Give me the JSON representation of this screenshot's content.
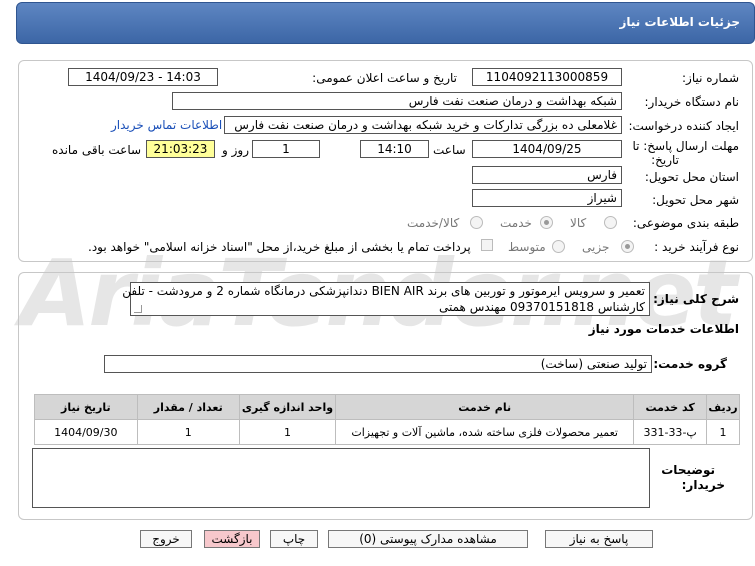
{
  "header": {
    "title": "جزئیات اطلاعات نیاز"
  },
  "form": {
    "need_number_label": "شماره نیاز:",
    "need_number": "1104092113000859",
    "announce_label": "تاریخ و ساعت اعلان عمومی:",
    "announce_value": "1404/09/23 - 14:03",
    "buyer_org_label": "نام دستگاه خریدار:",
    "buyer_org": "شبکه بهداشت و درمان صنعت نفت فارس",
    "creator_label": "ایجاد کننده درخواست:",
    "creator": "غلامعلی ده بزرگی تدارکات و خرید شبکه بهداشت و درمان صنعت نفت فارس",
    "contact_link": "اطلاعات تماس خریدار",
    "deadline_label_1": "مهلت ارسال پاسخ: تا",
    "deadline_label_2": "تاریخ:",
    "deadline_date": "1404/09/25",
    "time_label": "ساعت",
    "deadline_time": "14:10",
    "days_value": "1",
    "days_label": "روز و",
    "remaining_value": "21:03:23",
    "remaining_label": "ساعت باقی مانده",
    "province_label": "استان محل تحویل:",
    "province": "فارس",
    "city_label": "شهر محل تحویل:",
    "city": "شیراز",
    "category_label": "طبقه بندی موضوعی:",
    "category_options": [
      "کالا",
      "خدمت",
      "کالا/خدمت"
    ],
    "category_selected": "خدمت",
    "process_label": "نوع فرآیند خرید :",
    "process_options": [
      "جزیی",
      "متوسط"
    ],
    "process_selected": "جزیی",
    "treasury_note": "پرداخت تمام یا بخشی از مبلغ خرید،از محل \"اسناد خزانه اسلامی\" خواهد بود."
  },
  "description": {
    "label": "شرح کلی نیاز:",
    "line1": "تعمیر و سرویس ایرموتور و توربین های برند BIEN AIR دندانپزشکی درمانگاه شماره 2 و مرودشت - تلفن",
    "line2": "کارشناس 09370151818 مهندس همتی"
  },
  "services": {
    "section_title": "اطلاعات خدمات مورد نیاز",
    "group_label": "گروه خدمت:",
    "group_value": "تولید صنعتی (ساخت)",
    "columns": [
      "ردیف",
      "کد خدمت",
      "نام خدمت",
      "واحد اندازه گیری",
      "تعداد / مقدار",
      "تاریخ نیاز"
    ],
    "rows": [
      [
        "1",
        "پ-33-331",
        "تعمیر محصولات فلزی ساخته شده، ماشین آلات و تجهیزات",
        "1",
        "1",
        "1404/09/30"
      ]
    ]
  },
  "buyer_notes": {
    "label_1": "توضیحات",
    "label_2": "خریدار:"
  },
  "buttons": {
    "reply": "پاسخ به نیاز",
    "attachments": "مشاهده مدارک پیوستی (0)",
    "print": "چاپ",
    "back": "بازگشت",
    "exit": "خروج"
  },
  "watermark": "AriaTender.net",
  "colors": {
    "header": "#4a73b3",
    "highlight": "#ffff99",
    "link": "#1a4fb8",
    "back_button": "#f7c8cc"
  }
}
